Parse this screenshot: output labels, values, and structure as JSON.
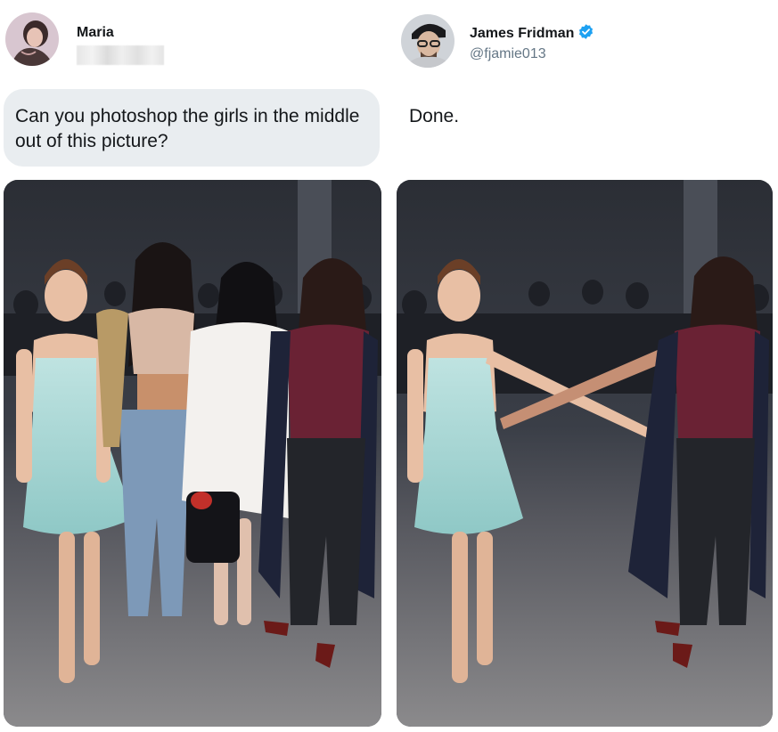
{
  "left_tweet": {
    "user_name": "Maria",
    "handle_hidden": true,
    "avatar_icon": "user-avatar-photo",
    "message": "Can you photoshop the girls in the middle out of this picture?",
    "photo": {
      "description_icon": "group-photo-original"
    }
  },
  "right_tweet": {
    "user_name": "James Fridman",
    "handle": "@fjamie013",
    "verified_icon": "verified-badge-icon",
    "verified_color": "#1da1f2",
    "avatar_icon": "user-avatar-photo",
    "message": "Done.",
    "photo": {
      "description_icon": "group-photo-edited"
    }
  },
  "colors": {
    "bubble_bg": "#e9edf0",
    "name_text": "#14171a",
    "handle_text": "#657786"
  }
}
